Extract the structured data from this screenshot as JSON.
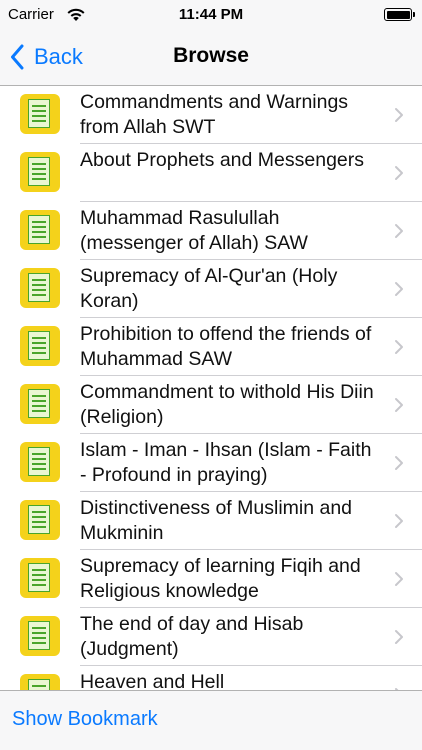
{
  "status_bar": {
    "carrier": "Carrier",
    "time": "11:44 PM"
  },
  "nav": {
    "back_label": "Back",
    "title": "Browse"
  },
  "items": [
    {
      "label": "Commandments and Warnings from Allah SWT"
    },
    {
      "label": "About Prophets and Messengers"
    },
    {
      "label": "Muhammad Rasulullah (messenger of Allah) SAW"
    },
    {
      "label": "Supremacy of Al-Qur'an (Holy Koran)"
    },
    {
      "label": "Prohibition to offend the friends of Muhammad SAW"
    },
    {
      "label": "Commandment to withold His Diin (Religion)"
    },
    {
      "label": "Islam - Iman - Ihsan (Islam - Faith - Profound in praying)"
    },
    {
      "label": "Distinctiveness of Muslimin and Mukminin"
    },
    {
      "label": "Supremacy of learning Fiqih and Religious knowledge"
    },
    {
      "label": "The end of day and Hisab (Judgment)"
    },
    {
      "label": "Heaven and Hell"
    }
  ],
  "toolbar": {
    "bookmark_label": "Show Bookmark"
  },
  "colors": {
    "accent": "#0a7aff",
    "icon_bg": "#f4d21b",
    "icon_page": "#4aa52a"
  },
  "icons": {
    "row_icon": "notepad-icon",
    "row_accessory": "chevron-right-icon",
    "back": "chevron-left-icon"
  }
}
